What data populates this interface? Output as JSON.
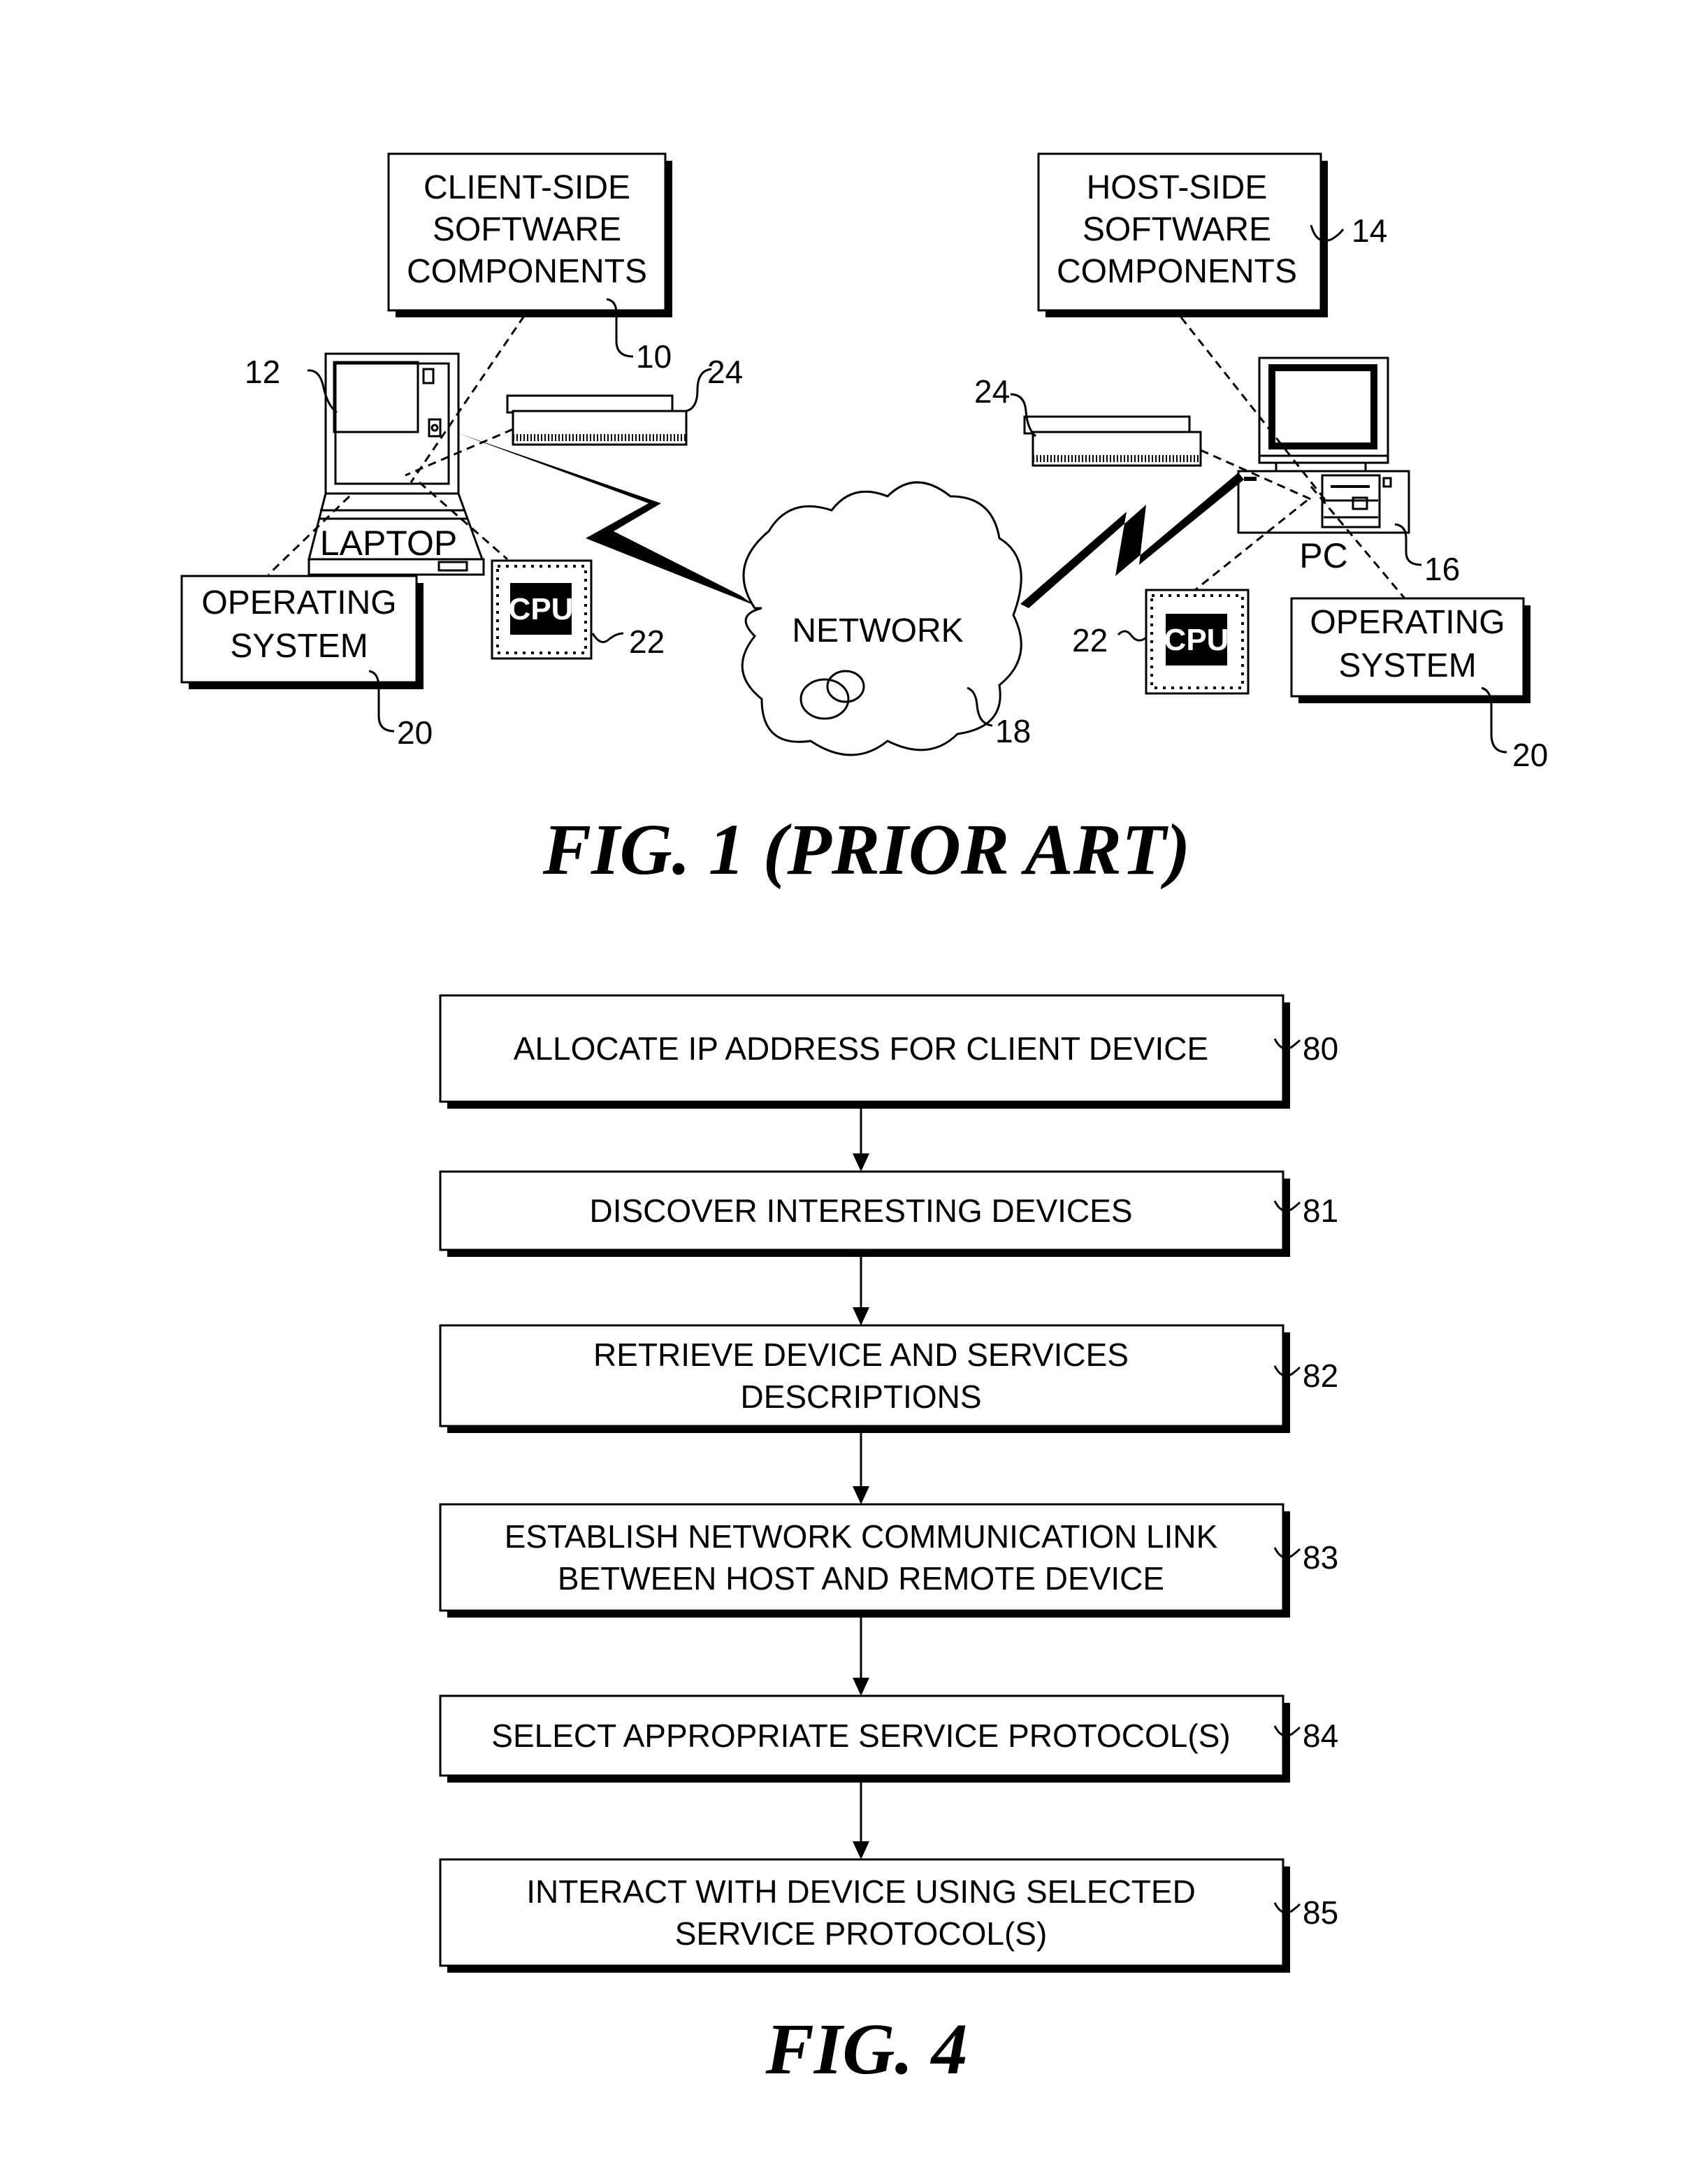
{
  "figure1": {
    "caption": "FIG. 1 (PRIOR ART)",
    "client_software": {
      "lines": [
        "CLIENT-SIDE",
        "SOFTWARE",
        "COMPONENTS"
      ],
      "ref": "10"
    },
    "host_software": {
      "lines": [
        "HOST-SIDE",
        "SOFTWARE",
        "COMPONENTS"
      ],
      "ref": "14"
    },
    "laptop": {
      "label": "LAPTOP",
      "ref": "12"
    },
    "pc": {
      "label": "PC",
      "ref": "16"
    },
    "network": {
      "label": "NETWORK",
      "ref": "18"
    },
    "os_left": {
      "lines": [
        "OPERATING",
        "SYSTEM"
      ],
      "ref": "20"
    },
    "os_right": {
      "lines": [
        "OPERATING",
        "SYSTEM"
      ],
      "ref": "20"
    },
    "cpu_left": {
      "label": "CPU",
      "ref": "22"
    },
    "cpu_right": {
      "label": "CPU",
      "ref": "22"
    },
    "memory_left": {
      "ref": "24"
    },
    "memory_right": {
      "ref": "24"
    }
  },
  "figure4": {
    "caption": "FIG. 4",
    "steps": [
      {
        "lines": [
          "ALLOCATE IP ADDRESS FOR CLIENT DEVICE"
        ],
        "ref": "80"
      },
      {
        "lines": [
          "DISCOVER INTERESTING DEVICES"
        ],
        "ref": "81"
      },
      {
        "lines": [
          "RETRIEVE DEVICE  AND SERVICES",
          "DESCRIPTIONS"
        ],
        "ref": "82"
      },
      {
        "lines": [
          "ESTABLISH NETWORK COMMUNICATION LINK",
          "BETWEEN HOST AND REMOTE DEVICE"
        ],
        "ref": "83"
      },
      {
        "lines": [
          "SELECT APPROPRIATE SERVICE PROTOCOL(S)"
        ],
        "ref": "84"
      },
      {
        "lines": [
          "INTERACT WITH DEVICE USING SELECTED",
          "SERVICE PROTOCOL(S)"
        ],
        "ref": "85"
      }
    ]
  }
}
